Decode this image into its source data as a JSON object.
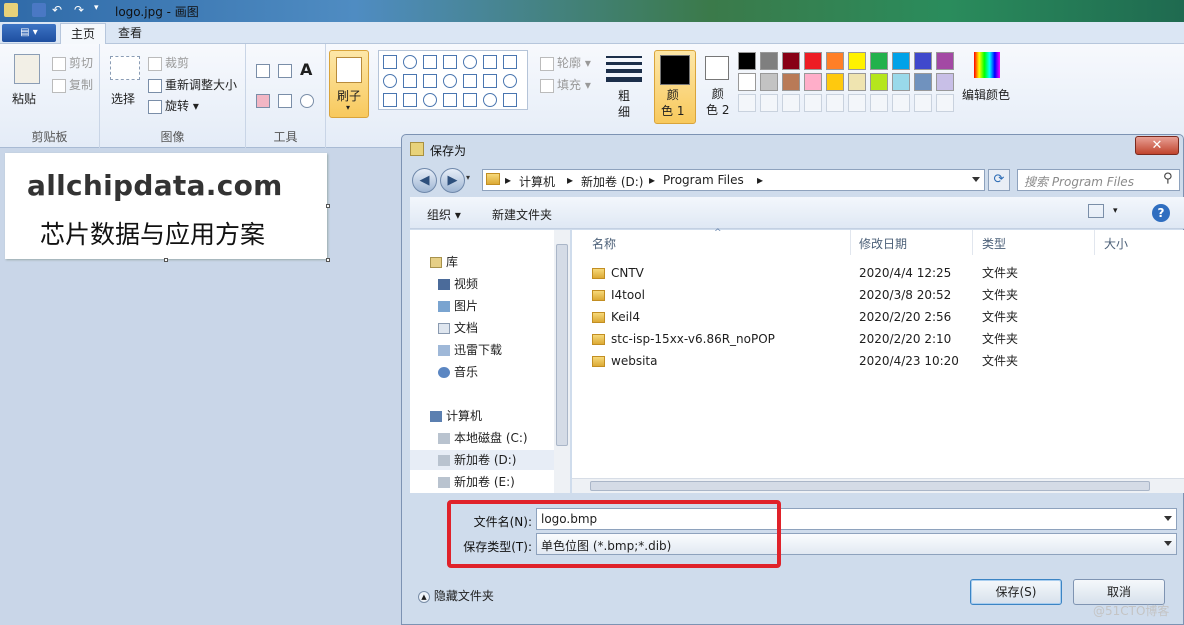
{
  "window": {
    "title": "logo.jpg - 画图"
  },
  "tabs": [
    {
      "label": "主页"
    },
    {
      "label": "查看"
    }
  ],
  "ribbon": {
    "clipboard": {
      "paste": "粘贴",
      "cut": "剪切",
      "copy": "复制",
      "group_label": "剪贴板"
    },
    "image": {
      "select": "选择",
      "crop": "裁剪",
      "resize": "重新调整大小",
      "rotate": "旋转",
      "group_label": "图像"
    },
    "tools": {
      "group_label": "工具"
    },
    "brush": {
      "label": "刷子"
    },
    "shapes": {
      "outline": "轮廓",
      "fill": "填充"
    },
    "size": {
      "label": "粗\n细"
    },
    "color1": {
      "label": "颜\n色 1"
    },
    "color2": {
      "label": "颜\n色 2"
    },
    "edit_colors": "编辑颜色",
    "palette_row1": [
      "#000000",
      "#7f7f7f",
      "#880015",
      "#ed1c24",
      "#ff7f27",
      "#fff200",
      "#22b14c",
      "#00a2e8",
      "#3f48cc",
      "#a349a4"
    ],
    "palette_row2": [
      "#ffffff",
      "#c3c3c3",
      "#b97a57",
      "#ffaec9",
      "#ffc90e",
      "#efe4b0",
      "#b5e61d",
      "#99d9ea",
      "#7092be",
      "#c8bfe7"
    ]
  },
  "canvas": {
    "heading": "allchipdata.com",
    "subtitle": "芯片数据与应用方案"
  },
  "dialog": {
    "title": "保存为",
    "close": "✕",
    "breadcrumb": [
      "计算机",
      "新加卷 (D:)",
      "Program Files"
    ],
    "search_placeholder": "搜索 Program Files",
    "organize": "组织",
    "new_folder": "新建文件夹",
    "nav": {
      "libraries": "库",
      "items": [
        "视频",
        "图片",
        "文档",
        "迅雷下载",
        "音乐"
      ],
      "computer": "计算机",
      "drives": [
        "本地磁盘 (C:)",
        "新加卷 (D:)",
        "新加卷 (E:)"
      ]
    },
    "columns": {
      "name": "名称",
      "date": "修改日期",
      "type": "类型",
      "size": "大小"
    },
    "files": [
      {
        "name": "CNTV",
        "date": "2020/4/4 12:25",
        "type": "文件夹"
      },
      {
        "name": "I4tool",
        "date": "2020/3/8 20:52",
        "type": "文件夹"
      },
      {
        "name": "Keil4",
        "date": "2020/2/20 2:56",
        "type": "文件夹"
      },
      {
        "name": "stc-isp-15xx-v6.86R_noPOP",
        "date": "2020/2/20 2:10",
        "type": "文件夹"
      },
      {
        "name": "websita",
        "date": "2020/4/23 10:20",
        "type": "文件夹"
      }
    ],
    "filename_label": "文件名(N):",
    "filename_value": "logo.bmp",
    "filetype_label": "保存类型(T):",
    "filetype_value": "单色位图 (*.bmp;*.dib)",
    "hide_folders": "隐藏文件夹",
    "save": "保存(S)",
    "cancel": "取消"
  },
  "watermark": "@51CTO博客"
}
